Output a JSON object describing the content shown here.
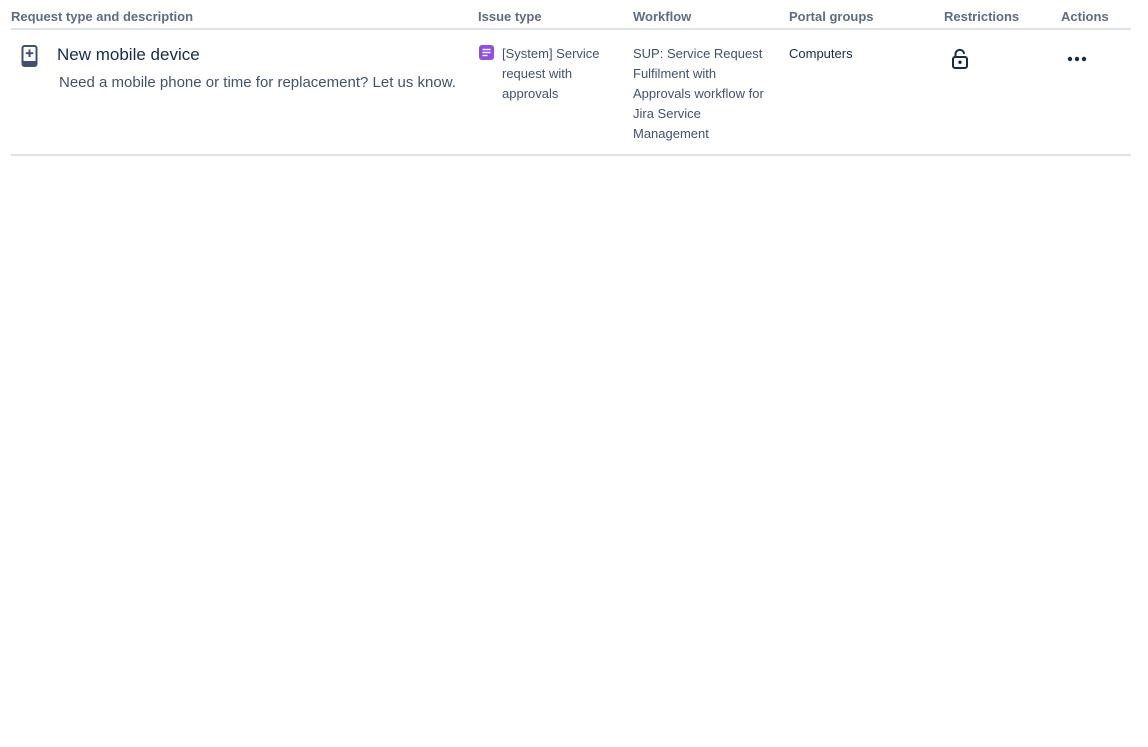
{
  "table": {
    "headers": {
      "request_type": "Request type and description",
      "issue_type": "Issue type",
      "workflow": "Workflow",
      "portal_groups": "Portal groups",
      "restrictions": "Restrictions",
      "actions": "Actions"
    },
    "rows": [
      {
        "icon": "mobile-device-add-icon",
        "name": "New mobile device",
        "description": "Need a mobile phone or time for replacement? Let us know.",
        "issue_type": {
          "icon": "service-request-icon",
          "icon_color": "#904ee2",
          "label": "[System] Service request with approvals"
        },
        "workflow": "SUP: Service Request Fulfilment with Approvals workflow for Jira Service Management",
        "portal_group": "Computers",
        "restrictions_icon": "unlock-icon",
        "actions_icon": "more-icon"
      }
    ]
  },
  "colors": {
    "header_text": "#5e6c84",
    "body_text": "#42526e",
    "title_text": "#172b4d",
    "divider": "#dfe1e6",
    "issue_type_accent": "#904ee2"
  }
}
